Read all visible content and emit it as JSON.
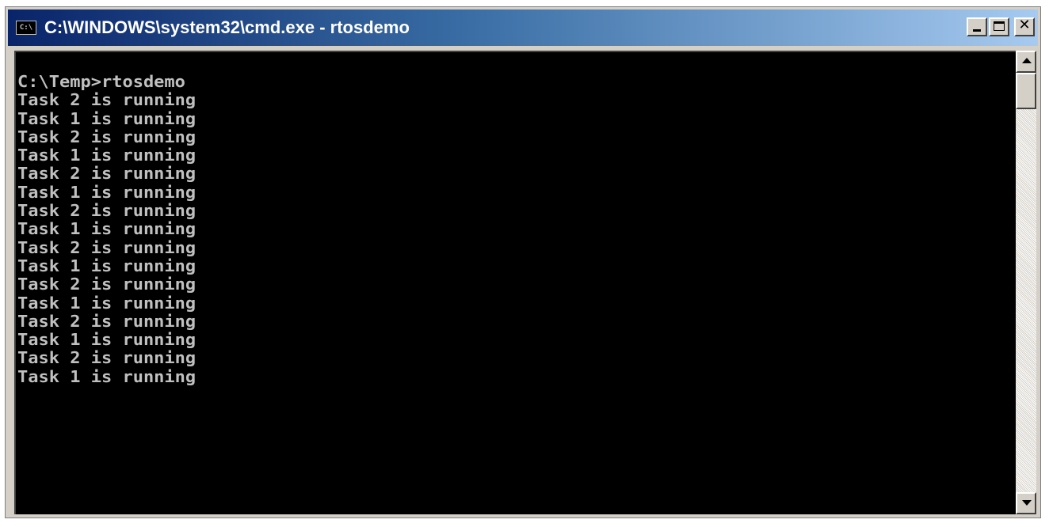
{
  "window": {
    "title": "C:\\WINDOWS\\system32\\cmd.exe - rtosdemo",
    "icon_text": "C:\\"
  },
  "console": {
    "lines": [
      "C:\\Temp>rtosdemo",
      "Task 2 is running",
      "Task 1 is running",
      "Task 2 is running",
      "Task 1 is running",
      "Task 2 is running",
      "Task 1 is running",
      "Task 2 is running",
      "Task 1 is running",
      "Task 2 is running",
      "Task 1 is running",
      "Task 2 is running",
      "Task 1 is running",
      "Task 2 is running",
      "Task 1 is running",
      "Task 2 is running",
      "Task 1 is running"
    ]
  },
  "icons": {
    "minimize": "minimize-icon",
    "maximize": "maximize-icon",
    "close": "close-icon",
    "scroll_up": "arrow-up-icon",
    "scroll_down": "arrow-down-icon"
  },
  "colors": {
    "titlebar_start": "#0a246a",
    "titlebar_end": "#a6caf0",
    "console_bg": "#000000",
    "console_text": "#c0c0c0"
  }
}
